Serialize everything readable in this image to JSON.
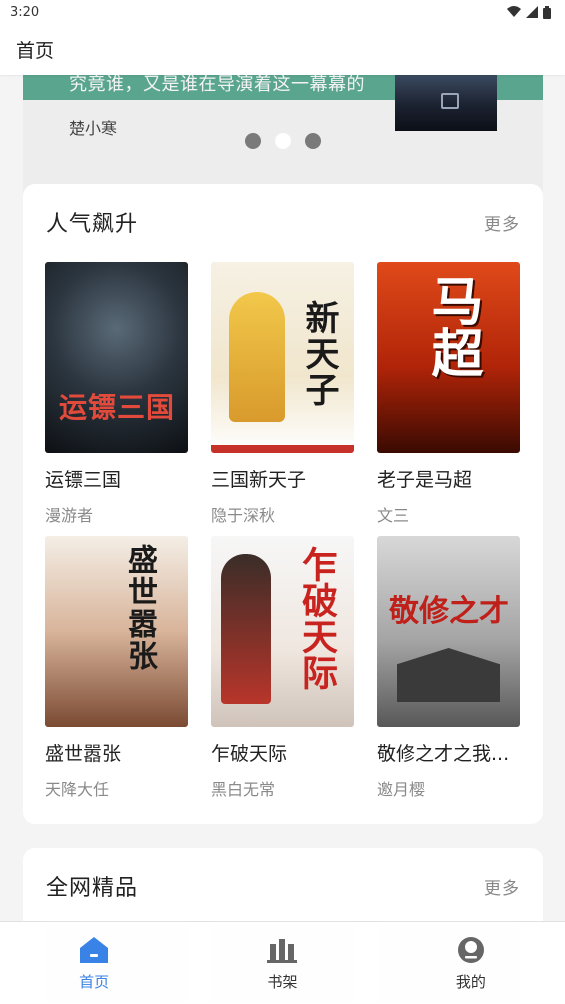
{
  "status_bar": {
    "time": "3:20"
  },
  "app_bar": {
    "title": "首页"
  },
  "banner": {
    "text": "究竟谁，又是谁在导演着这一幕幕的",
    "author": "楚小寒",
    "dot_count": 3,
    "active_dot": 1
  },
  "popular": {
    "title": "人气飙升",
    "more": "更多",
    "books": [
      {
        "name": "运镖三国",
        "author": "漫游者",
        "cover_text": "运镖三国"
      },
      {
        "name": "三国新天子",
        "author": "隐于深秋",
        "cover_text": "新天子"
      },
      {
        "name": "老子是马超",
        "author": "文三",
        "cover_text": "马超"
      },
      {
        "name": "盛世嚣张",
        "author": "天降大任",
        "cover_text": "盛世嚣张"
      },
      {
        "name": "乍破天际",
        "author": "黑白无常",
        "cover_text": "乍破天际"
      },
      {
        "name": "敬修之才之我...",
        "author": "邀月樱",
        "cover_text": "敬修之才"
      }
    ]
  },
  "premium": {
    "title": "全网精品",
    "more": "更多"
  },
  "bottom_nav": {
    "items": [
      {
        "label": "首页",
        "icon": "home-icon"
      },
      {
        "label": "书架",
        "icon": "bookshelf-icon"
      },
      {
        "label": "我的",
        "icon": "profile-icon"
      }
    ]
  },
  "colors": {
    "accent": "#3a83e6",
    "banner_strip": "#5aa58e"
  }
}
